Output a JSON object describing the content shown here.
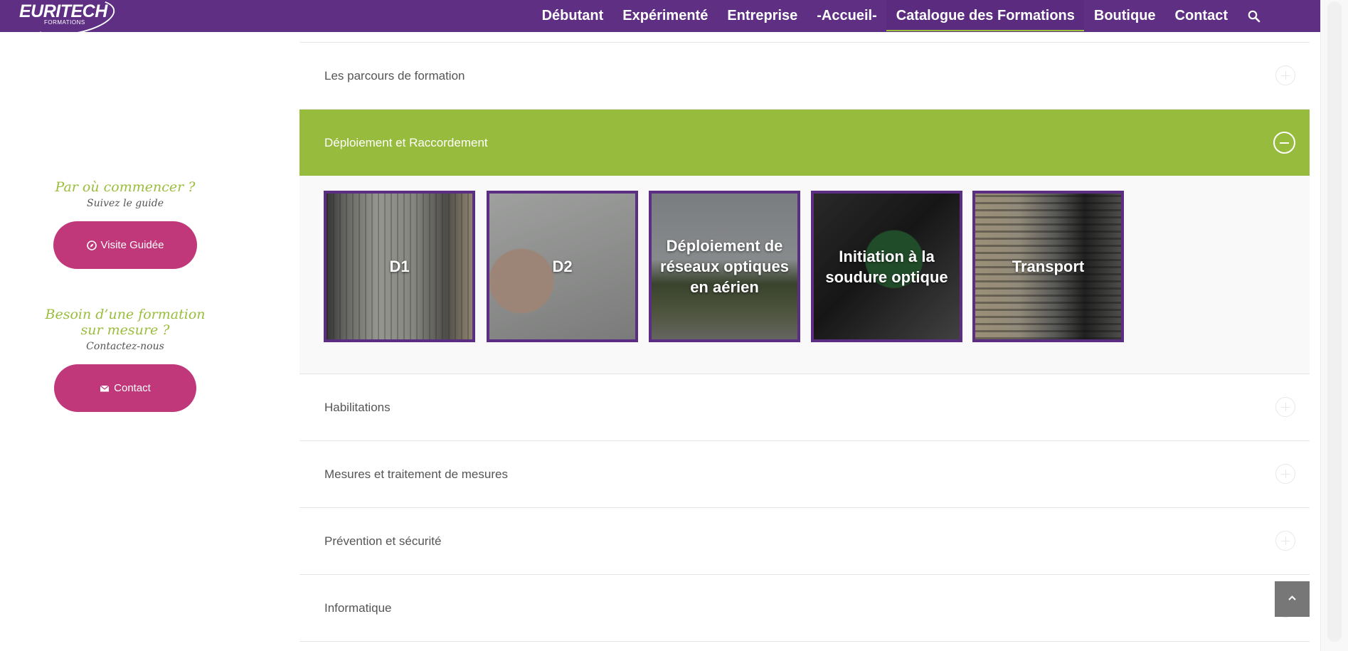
{
  "header": {
    "logo_text": "EURITECH",
    "logo_sub": "FORMATIONS",
    "nav": [
      {
        "label": "Débutant",
        "active": false
      },
      {
        "label": "Expérimenté",
        "active": false
      },
      {
        "label": "Entreprise",
        "active": false
      },
      {
        "label": "-Accueil-",
        "active": false
      },
      {
        "label": "Catalogue des Formations",
        "active": true
      },
      {
        "label": "Boutique",
        "active": false
      },
      {
        "label": "Contact",
        "active": false
      }
    ]
  },
  "sidebar": {
    "guide": {
      "title": "Par où commencer ?",
      "subtitle": "Suivez le guide",
      "button": "Visite Guidée"
    },
    "custom": {
      "title": "Besoin d’une formation sur mesure ?",
      "subtitle": "Contactez-nous",
      "button": "Contact"
    }
  },
  "accordion": {
    "items": [
      {
        "label": "Les parcours de formation"
      },
      {
        "label": "Déploiement et Raccordement"
      },
      {
        "label": "Habilitations"
      },
      {
        "label": "Mesures et traitement de mesures"
      },
      {
        "label": "Prévention et sécurité"
      },
      {
        "label": "Informatique"
      }
    ],
    "cards": [
      {
        "label": "D1"
      },
      {
        "label": "D2"
      },
      {
        "label": "Déploiement de réseaux optiques en aérien"
      },
      {
        "label": "Initiation à la soudure optique"
      },
      {
        "label": "Transport"
      }
    ]
  },
  "colors": {
    "brand_purple": "#5e2f83",
    "accent_green": "#97bb3c",
    "button_pink": "#c0377a"
  },
  "icons": {
    "search": "search-icon",
    "compass": "compass-icon",
    "mail": "mail-icon",
    "back_to_top": "chevron-up-icon"
  }
}
